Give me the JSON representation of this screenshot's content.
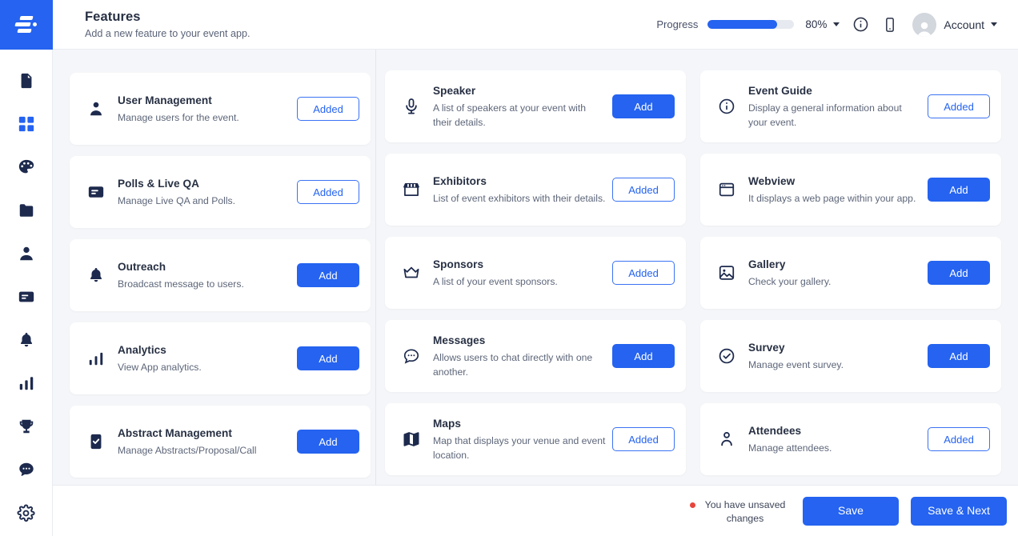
{
  "brand": {
    "logo_icon": "app-logo-icon",
    "accent": "#2563f0"
  },
  "sidebar": {
    "items": [
      {
        "icon": "document-icon",
        "name": "sidebar-item-documents",
        "active": false
      },
      {
        "icon": "grid-apps-icon",
        "name": "sidebar-item-features",
        "active": true
      },
      {
        "icon": "palette-icon",
        "name": "sidebar-item-design",
        "active": false
      },
      {
        "icon": "folder-icon",
        "name": "sidebar-item-files",
        "active": false
      },
      {
        "icon": "user-icon",
        "name": "sidebar-item-people",
        "active": false
      },
      {
        "icon": "card-icon",
        "name": "sidebar-item-content",
        "active": false
      },
      {
        "icon": "bell-icon",
        "name": "sidebar-item-notifications",
        "active": false
      },
      {
        "icon": "bar-chart-icon",
        "name": "sidebar-item-analytics",
        "active": false
      },
      {
        "icon": "trophy-icon",
        "name": "sidebar-item-gamification",
        "active": false
      },
      {
        "icon": "chat-icon",
        "name": "sidebar-item-messages",
        "active": false
      },
      {
        "icon": "gear-icon",
        "name": "sidebar-item-settings",
        "active": false
      }
    ]
  },
  "header": {
    "title": "Features",
    "subtitle": "Add a new feature to your event app.",
    "progress_label": "Progress",
    "progress_percent_text": "80%",
    "progress_value": 80,
    "info_icon": "info-circle-icon",
    "device_icon": "mobile-preview-icon",
    "account_label": "Account",
    "avatar_icon": "avatar-icon",
    "caret_icon": "chevron-down-icon"
  },
  "features": {
    "columns": [
      {
        "name": "column-1",
        "cards": [
          {
            "icon": "user-icon",
            "title": "User Management",
            "desc": "Manage users for the event.",
            "button": "Added",
            "state": "added"
          },
          {
            "icon": "poll-icon",
            "title": "Polls & Live QA",
            "desc": "Manage Live QA and Polls.",
            "button": "Added",
            "state": "added"
          },
          {
            "icon": "bell-icon",
            "title": "Outreach",
            "desc": "Broadcast message to users.",
            "button": "Add",
            "state": "add"
          },
          {
            "icon": "bar-chart-icon",
            "title": "Analytics",
            "desc": "View App analytics.",
            "button": "Add",
            "state": "add"
          },
          {
            "icon": "abstract-icon",
            "title": "Abstract Management",
            "desc": "Manage Abstracts/Proposal/Call",
            "button": "Add",
            "state": "add"
          }
        ]
      },
      {
        "name": "column-2",
        "cards": [
          {
            "icon": "microphone-icon",
            "title": "Speaker",
            "desc": "A list of speakers at your event with their details.",
            "button": "Add",
            "state": "add"
          },
          {
            "icon": "store-icon",
            "title": "Exhibitors",
            "desc": "List of event exhibitors with their details.",
            "button": "Added",
            "state": "added"
          },
          {
            "icon": "crown-icon",
            "title": "Sponsors",
            "desc": "A list of your event sponsors.",
            "button": "Added",
            "state": "added"
          },
          {
            "icon": "chat-icon",
            "title": "Messages",
            "desc": "Allows users to chat directly with one another.",
            "button": "Add",
            "state": "add"
          },
          {
            "icon": "map-icon",
            "title": "Maps",
            "desc": "Map that displays your venue and event location.",
            "button": "Added",
            "state": "added"
          }
        ]
      },
      {
        "name": "column-3",
        "cards": [
          {
            "icon": "info-circle-icon",
            "title": "Event Guide",
            "desc": "Display a general information about your event.",
            "button": "Added",
            "state": "added"
          },
          {
            "icon": "webview-icon",
            "title": "Webview",
            "desc": "It displays a web page within your app.",
            "button": "Add",
            "state": "add"
          },
          {
            "icon": "image-icon",
            "title": "Gallery",
            "desc": "Check your gallery.",
            "button": "Add",
            "state": "add"
          },
          {
            "icon": "check-circle-icon",
            "title": "Survey",
            "desc": "Manage event survey.",
            "button": "Add",
            "state": "add"
          },
          {
            "icon": "person-icon",
            "title": "Attendees",
            "desc": "Manage attendees.",
            "button": "Added",
            "state": "added"
          }
        ]
      }
    ]
  },
  "footer": {
    "unsaved_text": "You have unsaved changes",
    "unsaved_dot_color": "#e8453c",
    "save_label": "Save",
    "save_next_label": "Save & Next"
  }
}
